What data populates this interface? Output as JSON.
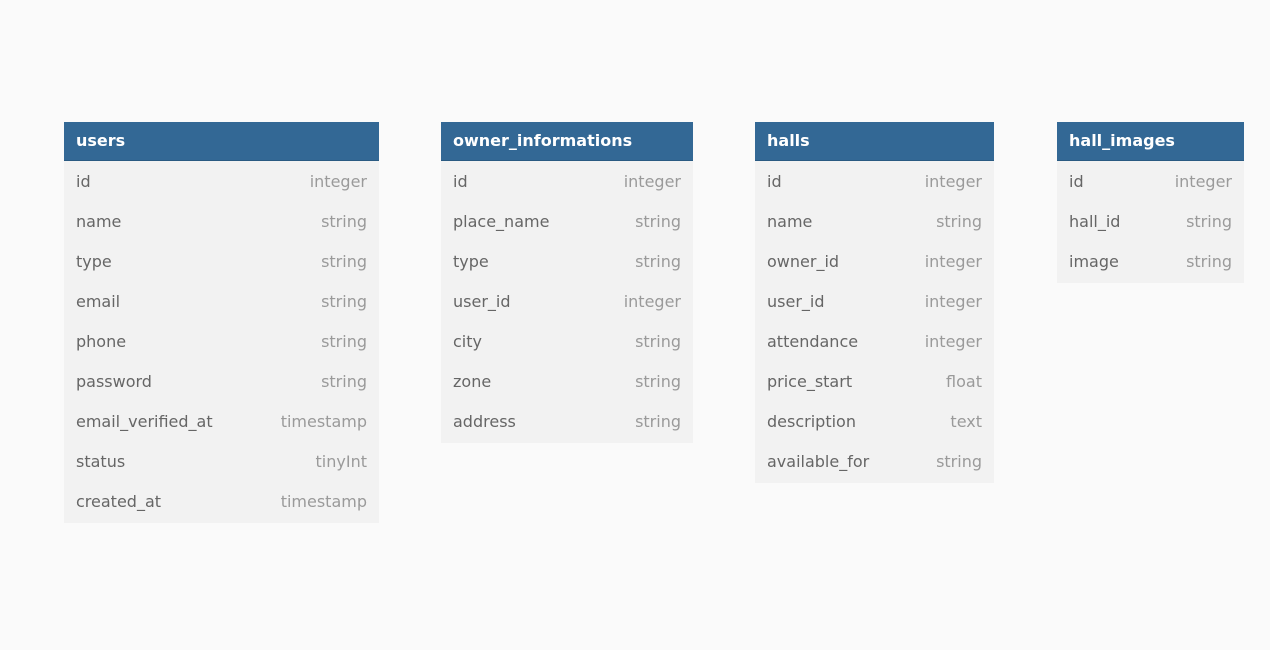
{
  "tables": [
    {
      "name": "users",
      "columns": [
        {
          "name": "id",
          "type": "integer"
        },
        {
          "name": "name",
          "type": "string"
        },
        {
          "name": "type",
          "type": "string"
        },
        {
          "name": "email",
          "type": "string"
        },
        {
          "name": "phone",
          "type": "string"
        },
        {
          "name": "password",
          "type": "string"
        },
        {
          "name": "email_verified_at",
          "type": "timestamp"
        },
        {
          "name": "status",
          "type": "tinyInt"
        },
        {
          "name": "created_at",
          "type": "timestamp"
        }
      ]
    },
    {
      "name": "owner_informations",
      "columns": [
        {
          "name": "id",
          "type": "integer"
        },
        {
          "name": "place_name",
          "type": "string"
        },
        {
          "name": "type",
          "type": "string"
        },
        {
          "name": "user_id",
          "type": "integer"
        },
        {
          "name": "city",
          "type": "string"
        },
        {
          "name": "zone",
          "type": "string"
        },
        {
          "name": "address",
          "type": "string"
        }
      ]
    },
    {
      "name": "halls",
      "columns": [
        {
          "name": "id",
          "type": "integer"
        },
        {
          "name": "name",
          "type": "string"
        },
        {
          "name": "owner_id",
          "type": "integer"
        },
        {
          "name": "user_id",
          "type": "integer"
        },
        {
          "name": "attendance",
          "type": "integer"
        },
        {
          "name": "price_start",
          "type": "float"
        },
        {
          "name": "description",
          "type": "text"
        },
        {
          "name": "available_for",
          "type": "string"
        }
      ]
    },
    {
      "name": "hall_images",
      "columns": [
        {
          "name": "id",
          "type": "integer"
        },
        {
          "name": "hall_id",
          "type": "string"
        },
        {
          "name": "image",
          "type": "string"
        }
      ]
    }
  ]
}
